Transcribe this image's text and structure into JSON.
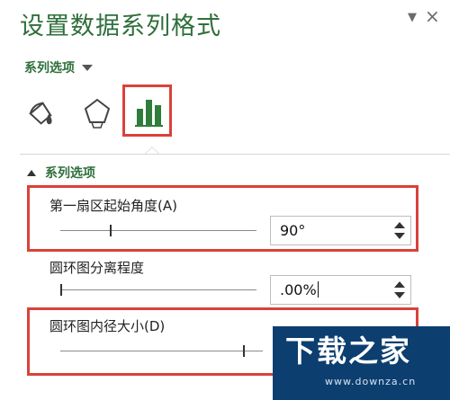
{
  "pane": {
    "title": "设置数据系列格式",
    "dropdown_glyph": "▼",
    "close_glyph": "×"
  },
  "options_dropdown": {
    "label": "系列选项"
  },
  "icon_tabs": [
    {
      "icon": "fill-line-icon",
      "selected": false
    },
    {
      "icon": "effects-pentagon-icon",
      "selected": false
    },
    {
      "icon": "series-options-bar-chart-icon",
      "selected": true
    }
  ],
  "section": {
    "label": "系列选项",
    "expanded": true
  },
  "settings": {
    "first_slice_angle": {
      "label": "第一扇区起始角度(A)",
      "value": "90°",
      "slider_fraction": 0.25
    },
    "doughnut_explosion": {
      "label": "圆环图分离程度",
      "value": ".00%",
      "slider_fraction": 0.0
    },
    "doughnut_hole_size": {
      "label": "圆环图内径大小(D)",
      "slider_fraction": 0.9
    }
  },
  "watermark": {
    "brand": "下载之家",
    "url": "www.downza.cn"
  },
  "colors": {
    "accent_green": "#2f6f3b",
    "highlight_red": "#d9423a",
    "watermark_bg": "#0c3e70"
  }
}
